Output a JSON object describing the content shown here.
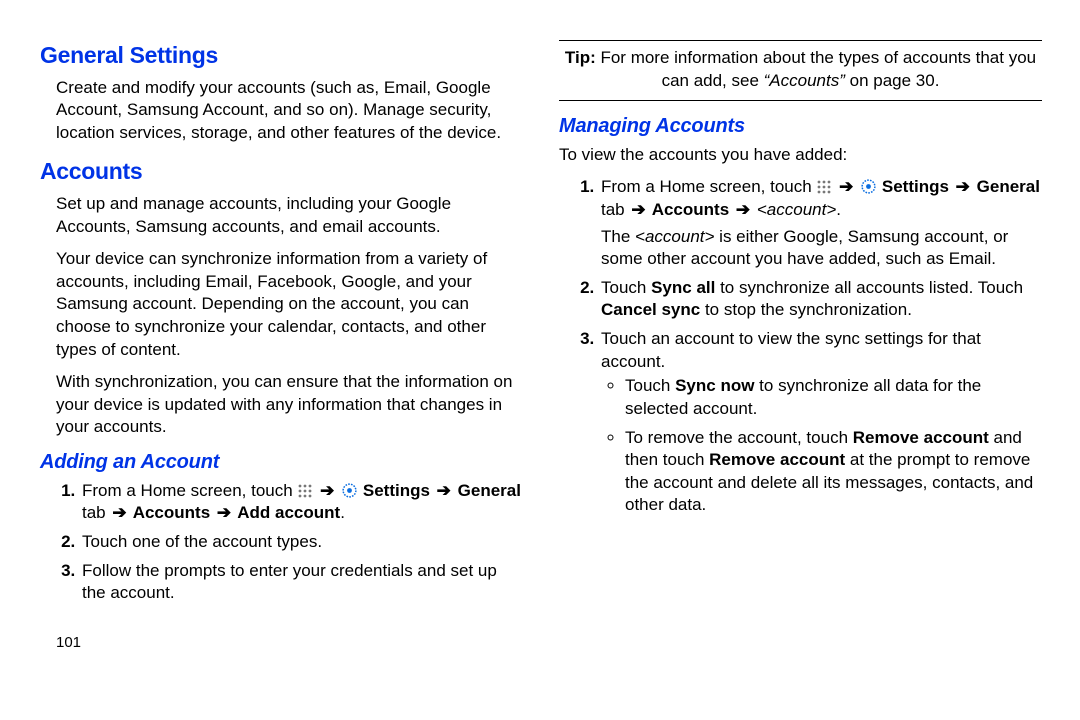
{
  "left": {
    "h1a": "General Settings",
    "p1": "Create and modify your accounts (such as, Email, Google Account, Samsung Account, and so on). Manage security, location services, storage, and other features of the device.",
    "h1b": "Accounts",
    "p2": "Set up and manage accounts, including your Google Accounts, Samsung accounts, and email accounts.",
    "p3": "Your device can synchronize information from a variety of accounts, including Email, Facebook, Google, and your Samsung account. Depending on the account, you can choose to synchronize your calendar, contacts, and other types of content.",
    "p4": "With synchronization, you can ensure that the information on your device is updated with any information that changes in your accounts.",
    "h2": "Adding an Account",
    "step1_pre": "From a Home screen, touch ",
    "arrow": "➔",
    "settings_lbl": " Settings ",
    "general_tab": "General",
    "tab_word": " tab ",
    "accounts_lbl": " Accounts ",
    "add_account_lbl": " Add account",
    "step2": "Touch one of the account types.",
    "step3": "Follow the prompts to enter your credentials and set up the account.",
    "pagenum": "101"
  },
  "right": {
    "tip_label": "Tip:",
    "tip_text_a": " For more information about the types of accounts that you can add, see ",
    "tip_ref": "“Accounts”",
    "tip_text_b": " on page 30.",
    "h2": "Managing Accounts",
    "intro": "To view the accounts you have added:",
    "step1_pre": "From a Home screen, touch ",
    "arrow": "➔",
    "settings_lbl": " Settings ",
    "general_tab": "General",
    "tab_word": " tab ",
    "accounts_lbl": " Accounts ",
    "account_placeholder": "<account>",
    "step1_body_a": "The ",
    "step1_body_b": " is either Google, Samsung account, or some other account you have added, such as Email.",
    "step2_a": "Touch ",
    "sync_all": "Sync all",
    "step2_b": " to synchronize all accounts listed. Touch ",
    "cancel_sync": "Cancel sync",
    "step2_c": " to stop the synchronization.",
    "step3": "Touch an account to view the sync settings for that account.",
    "bullet1_a": "Touch ",
    "sync_now": "Sync now",
    "bullet1_b": " to synchronize all data for the selected account.",
    "bullet2_a": "To remove the account, touch ",
    "remove_account": "Remove account",
    "bullet2_b": " and then touch ",
    "bullet2_c": " at the prompt to remove the account and delete all its messages, contacts, and other data."
  }
}
